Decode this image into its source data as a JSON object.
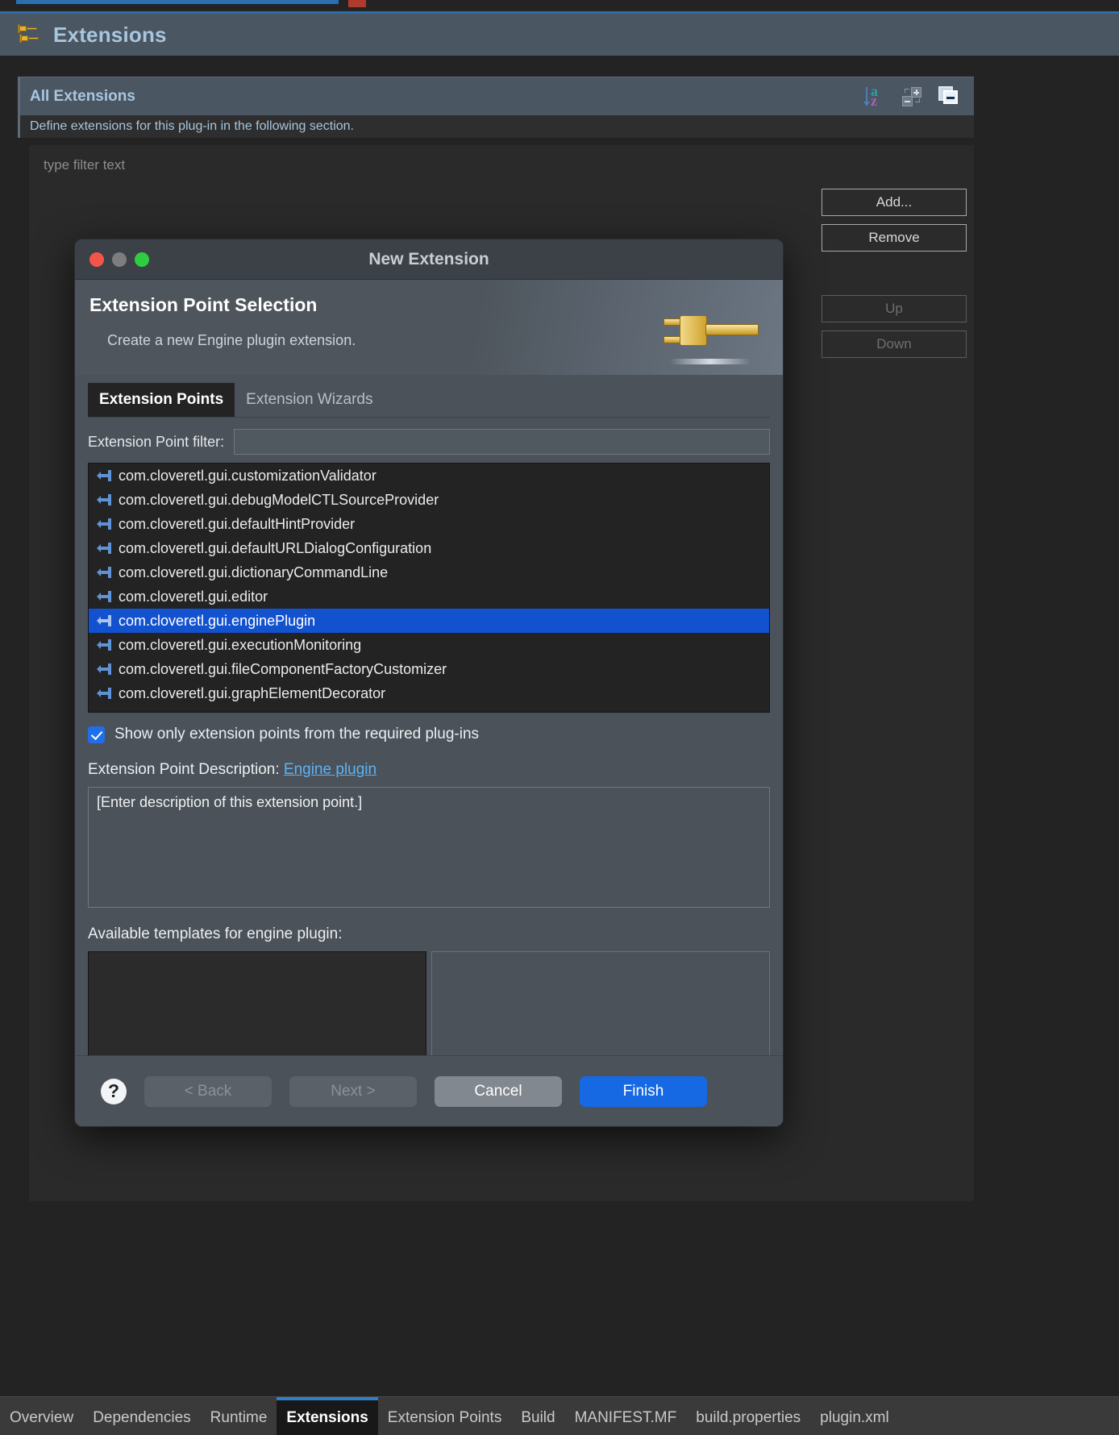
{
  "form": {
    "header_title": "Extensions",
    "header_icon": "plug-extensions-icon",
    "section_title": "All Extensions",
    "section_description": "Define extensions for this plug-in in the following section.",
    "filter_placeholder": "type filter text",
    "tools": [
      {
        "name": "sort-az-icon",
        "label": "Sort"
      },
      {
        "name": "expand-collapse-icon",
        "label": "Expand/Collapse"
      },
      {
        "name": "restore-view-icon",
        "label": "Restore"
      }
    ],
    "side_buttons": [
      {
        "label": "Add...",
        "enabled": true
      },
      {
        "label": "Remove",
        "enabled": true
      },
      {
        "label": "Up",
        "enabled": false
      },
      {
        "label": "Down",
        "enabled": false
      }
    ]
  },
  "dialog": {
    "window_title": "New Extension",
    "traffic_lights": [
      "close",
      "minimize",
      "maximize"
    ],
    "heading": "Extension Point Selection",
    "subheading": "Create a new Engine plugin extension.",
    "banner_icon": "gold-plug-icon",
    "tabs": [
      {
        "label": "Extension Points",
        "active": true
      },
      {
        "label": "Extension Wizards",
        "active": false
      }
    ],
    "filter_label": "Extension Point filter:",
    "filter_value": "",
    "extension_points": [
      {
        "label": "com.cloveretl.gui.customizationValidator",
        "selected": false
      },
      {
        "label": "com.cloveretl.gui.debugModelCTLSourceProvider",
        "selected": false
      },
      {
        "label": "com.cloveretl.gui.defaultHintProvider",
        "selected": false
      },
      {
        "label": "com.cloveretl.gui.defaultURLDialogConfiguration",
        "selected": false
      },
      {
        "label": "com.cloveretl.gui.dictionaryCommandLine",
        "selected": false
      },
      {
        "label": "com.cloveretl.gui.editor",
        "selected": false
      },
      {
        "label": "com.cloveretl.gui.enginePlugin",
        "selected": true
      },
      {
        "label": "com.cloveretl.gui.executionMonitoring",
        "selected": false
      },
      {
        "label": "com.cloveretl.gui.fileComponentFactoryCustomizer",
        "selected": false
      },
      {
        "label": "com.cloveretl.gui.graphElementDecorator",
        "selected": false
      }
    ],
    "checkbox": {
      "label": "Show only extension points from the required plug-ins",
      "checked": true
    },
    "description_label": "Extension Point Description:",
    "description_link": "Engine plugin",
    "description_value": "[Enter description of this extension point.]",
    "templates_label": "Available templates for engine plugin:",
    "help_glyph": "?",
    "buttons": [
      {
        "label": "< Back",
        "state": "disabled"
      },
      {
        "label": "Next >",
        "state": "disabled"
      },
      {
        "label": "Cancel",
        "state": "normal"
      },
      {
        "label": "Finish",
        "state": "primary"
      }
    ]
  },
  "bottom_tabs": [
    {
      "label": "Overview",
      "active": false
    },
    {
      "label": "Dependencies",
      "active": false
    },
    {
      "label": "Runtime",
      "active": false
    },
    {
      "label": "Extensions",
      "active": true
    },
    {
      "label": "Extension Points",
      "active": false
    },
    {
      "label": "Build",
      "active": false
    },
    {
      "label": "MANIFEST.MF",
      "active": false
    },
    {
      "label": "build.properties",
      "active": false
    },
    {
      "label": "plugin.xml",
      "active": false
    }
  ],
  "colors": {
    "accent_blue": "#2f7fc9",
    "selection_blue": "#1352cf",
    "primary_button": "#1668e3",
    "header_text": "#a8c6dd",
    "link": "#5db3f5"
  }
}
